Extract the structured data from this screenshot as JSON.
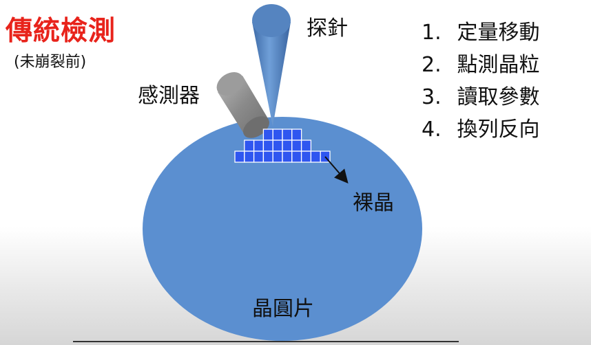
{
  "header": {
    "title": "傳統檢測",
    "subtitle": "(未崩裂前)"
  },
  "steps": [
    {
      "num": "1.",
      "text": "定量移動"
    },
    {
      "num": "2.",
      "text": "點測晶粒"
    },
    {
      "num": "3.",
      "text": "讀取參數"
    },
    {
      "num": "4.",
      "text": "換列反向"
    }
  ],
  "labels": {
    "probe": "探針",
    "sensor": "感測器",
    "die": "裸晶",
    "wafer": "晶圓片"
  },
  "colors": {
    "title": "#e8231b",
    "wafer": "#5b8fd0",
    "probe": "#4a7ab8",
    "sensor": "#8f8f8f",
    "die_grid": "#2f56f0"
  },
  "die_rows": [
    {
      "count": 4
    },
    {
      "count": 7
    },
    {
      "count": 10
    }
  ]
}
